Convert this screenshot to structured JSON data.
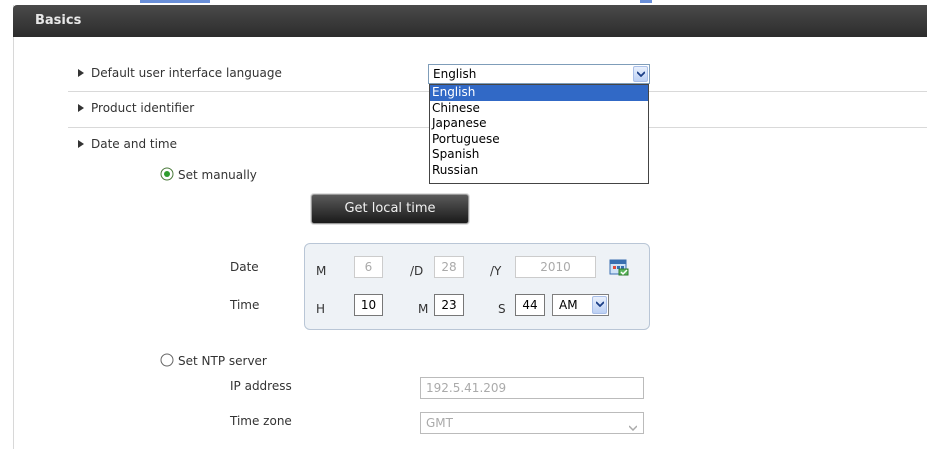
{
  "header": {
    "title": "Basics"
  },
  "settings": {
    "language_label": "Default user interface language",
    "language_value": "English",
    "language_options": [
      "English",
      "Chinese",
      "Japanese",
      "Portuguese",
      "Spanish",
      "Russian"
    ],
    "product_identifier_label": "Product identifier",
    "date_time_label": "Date and time",
    "set_manually_label": "Set manually",
    "get_local_time_label": "Get local time",
    "date_label": "Date",
    "time_label": "Time",
    "date": {
      "m_label": "M",
      "m_value": "6",
      "d_label": "/D",
      "d_value": "28",
      "y_label": "/Y",
      "y_value": "2010"
    },
    "time": {
      "h_label": "H",
      "h_value": "10",
      "m_label": "M",
      "m_value": "23",
      "s_label": "S",
      "s_value": "44",
      "ampm": "AM"
    },
    "ntp_label": "Set NTP server",
    "ip_label": "IP address",
    "ip_value": "192.5.41.209",
    "tz_label": "Time zone",
    "tz_value": "GMT"
  },
  "colors": {
    "header_bg": "#333333",
    "selected_option": "#3169c6"
  }
}
